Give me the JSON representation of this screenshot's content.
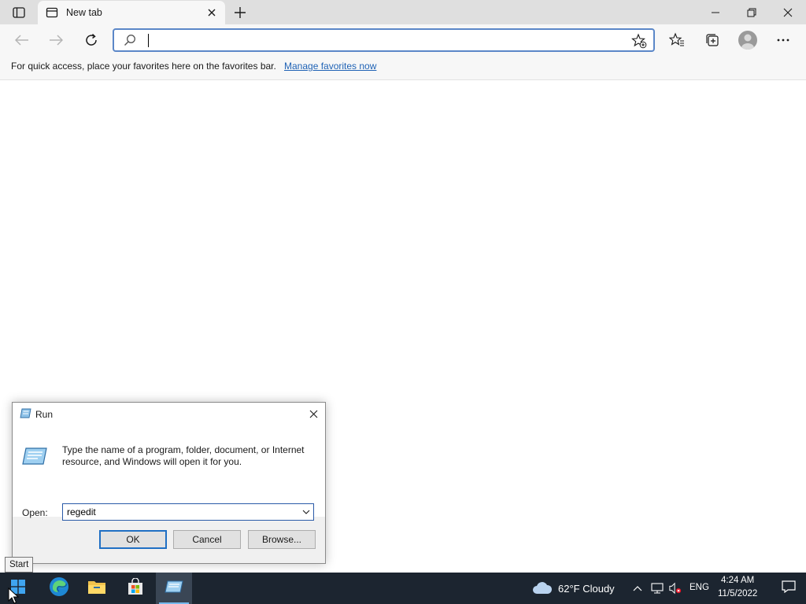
{
  "browser": {
    "tab": {
      "title": "New tab"
    },
    "address_bar": {
      "value": "",
      "placeholder": ""
    },
    "favorites_bar": {
      "message": "For quick access, place your favorites here on the favorites bar.",
      "link": "Manage favorites now"
    }
  },
  "run_dialog": {
    "title": "Run",
    "description": "Type the name of a program, folder, document, or Internet resource, and Windows will open it for you.",
    "open_label": "Open:",
    "open_value": "regedit",
    "buttons": {
      "ok": "OK",
      "cancel": "Cancel",
      "browse": "Browse..."
    }
  },
  "tooltip": {
    "text": "Start"
  },
  "taskbar": {
    "apps": [
      "start-icon",
      "edge-icon",
      "file-explorer-icon",
      "store-icon",
      "run-icon"
    ],
    "weather": "62°F  Cloudy",
    "language": "ENG",
    "time": "4:24 AM",
    "date": "11/5/2022"
  },
  "colors": {
    "taskbar": "#1c2530",
    "accent": "#1f6fc4",
    "link": "#1f62b5"
  }
}
